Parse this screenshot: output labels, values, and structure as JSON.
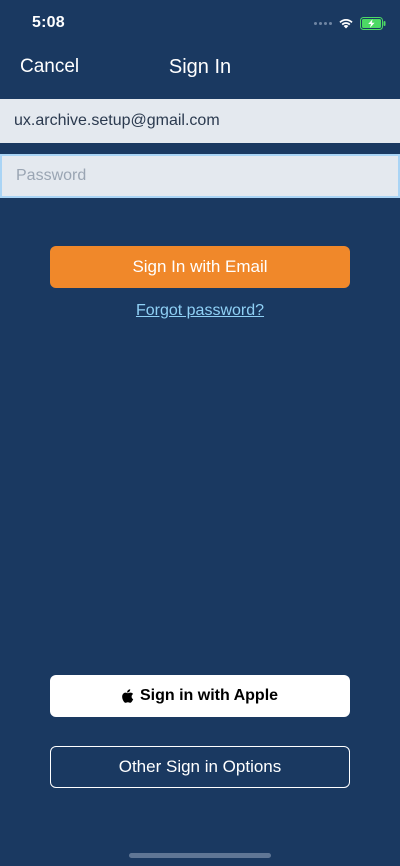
{
  "status_bar": {
    "time": "5:08",
    "icons": [
      "cellular-dots-icon",
      "wifi-icon",
      "battery-charging-icon"
    ],
    "battery_color": "#4cd964"
  },
  "nav": {
    "cancel_label": "Cancel",
    "title": "Sign In"
  },
  "form": {
    "email_value": "ux.archive.setup@gmail.com",
    "password_placeholder": "Password"
  },
  "actions": {
    "sign_in_email_label": "Sign In with Email",
    "forgot_password_label": "Forgot password?",
    "sign_in_apple_label": "Sign in with Apple",
    "other_options_label": "Other Sign in Options"
  },
  "colors": {
    "background": "#1a3961",
    "primary_button": "#f0882a",
    "link": "#8fd0f5",
    "field_background": "#e4e9ef",
    "focus_border": "#a9d4f5"
  }
}
